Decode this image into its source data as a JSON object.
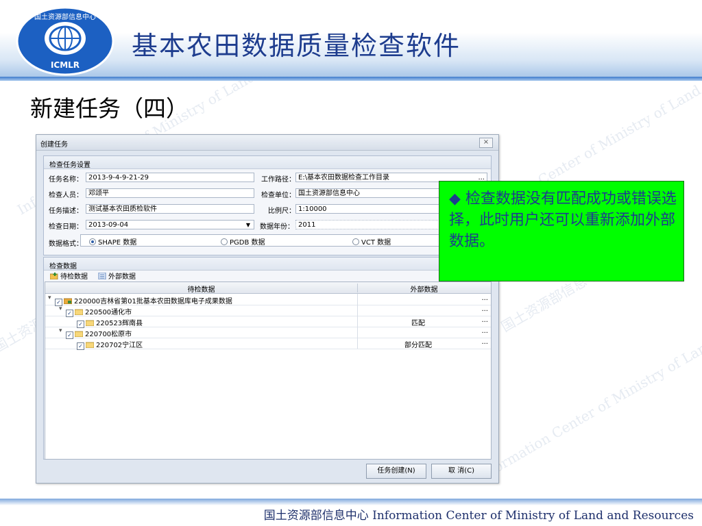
{
  "slide": {
    "title": "基本农田数据质量检查软件",
    "subtitle": "新建任务（四）",
    "logo_text": "ICMLR",
    "logo_ring_text": "国土资源部信息中心",
    "footer": "国土资源部信息中心  Information Center of Ministry of Land and Resources",
    "watermark": [
      "Information Center of Ministry of Land and Resources",
      "国土资源部信息中心"
    ]
  },
  "dialog": {
    "title": "创建任务",
    "close_label": "×",
    "settings_group": {
      "title": "检查任务设置",
      "task_name_label": "任务名称：",
      "task_name_value": "2013-9-4-9-21-29",
      "work_path_label": "工作路径：",
      "work_path_value": "E:\\基本农田数据检查工作目录",
      "checker_label": "检查人员：",
      "checker_value": "邓颂平",
      "unit_label": "检查单位：",
      "unit_value": "国土资源部信息中心",
      "desc_label": "任务描述：",
      "desc_value": "测试基本农田质检软件",
      "scale_label": "比例尺：",
      "scale_value": "1:10000",
      "date_label": "检查日期：",
      "date_value": "2013-09-04",
      "year_label": "数据年份：",
      "year_value": "2011",
      "format_label": "数据格式：",
      "formats": [
        "SHAPE 数据",
        "PGDB 数据",
        "VCT 数据"
      ],
      "selected_format": "SHAPE 数据",
      "ellipsis": "..."
    },
    "data_group": {
      "title": "检查数据",
      "tool_pending": "待检数据",
      "tool_external": "外部数据",
      "col_pending": "待检数据",
      "col_external": "外部数据",
      "rows": [
        {
          "name": "220000吉林省第01批基本农田数据库电子成果数据",
          "external": "",
          "dots": "..."
        },
        {
          "name": "220500通化市",
          "external": "",
          "dots": "..."
        },
        {
          "name": "220523辉南县",
          "external": "匹配",
          "dots": "..."
        },
        {
          "name": "220700松原市",
          "external": "",
          "dots": "..."
        },
        {
          "name": "220702宁江区",
          "external": "部分匹配",
          "dots": "..."
        }
      ]
    },
    "create_button": "任务创建(N)",
    "cancel_button": "取 消(C)"
  },
  "note": {
    "text": "检查数据没有匹配成功或错误选择，此时用户还可以重新添加外部数据。",
    "bullet": "◆"
  },
  "colors": {
    "title_blue": "#1d3c8e",
    "note_green": "#00ff00"
  }
}
